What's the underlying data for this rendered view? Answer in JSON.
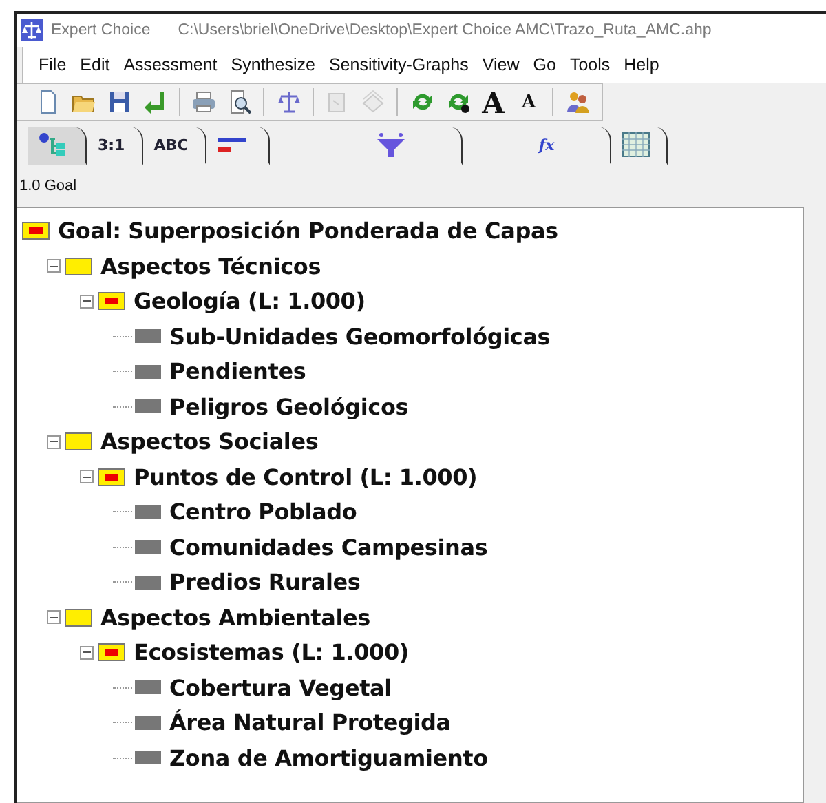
{
  "window": {
    "app": "Expert Choice",
    "path": "C:\\Users\\briel\\OneDrive\\Desktop\\Expert Choice AMC\\Trazo_Ruta_AMC.ahp"
  },
  "menu": [
    {
      "label": "File"
    },
    {
      "label": "Edit"
    },
    {
      "label": "Assessment"
    },
    {
      "label": "Synthesize"
    },
    {
      "label": "Sensitivity-Graphs"
    },
    {
      "label": "View"
    },
    {
      "label": "Go"
    },
    {
      "label": "Tools"
    },
    {
      "label": "Help"
    }
  ],
  "toolbar": [
    {
      "kind": "document",
      "disabled": false
    },
    {
      "kind": "folder",
      "disabled": false
    },
    {
      "kind": "floppy",
      "disabled": false
    },
    {
      "kind": "return",
      "disabled": false
    },
    {
      "kind": "separator"
    },
    {
      "kind": "printer",
      "disabled": false
    },
    {
      "kind": "preview",
      "disabled": false
    },
    {
      "kind": "separator"
    },
    {
      "kind": "scale",
      "disabled": false
    },
    {
      "kind": "separator"
    },
    {
      "kind": "copy",
      "disabled": true
    },
    {
      "kind": "stack",
      "disabled": true
    },
    {
      "kind": "separator"
    },
    {
      "kind": "recycle",
      "disabled": false
    },
    {
      "kind": "recycle-dot",
      "disabled": false
    },
    {
      "kind": "font-up",
      "label": "A",
      "disabled": false
    },
    {
      "kind": "font-down",
      "label": "A",
      "disabled": false
    },
    {
      "kind": "separator"
    },
    {
      "kind": "people",
      "disabled": false
    }
  ],
  "tabs": [
    {
      "kind": "tree",
      "selected": true
    },
    {
      "kind": "text",
      "label": "3:1",
      "selected": false
    },
    {
      "kind": "text",
      "label": "ABC",
      "selected": false
    },
    {
      "kind": "bars",
      "selected": false
    },
    {
      "kind": "funnel",
      "selected": false
    },
    {
      "kind": "formula",
      "label": "fx",
      "selected": false
    },
    {
      "kind": "grid",
      "selected": false
    }
  ],
  "breadcrumb": "1.0 Goal",
  "tree": {
    "kind": "goal",
    "label": "Goal: Superposición Ponderada de Capas",
    "children": [
      {
        "kind": "criterion",
        "label": "Aspectos Técnicos",
        "expanded": true,
        "children": [
          {
            "kind": "subcriterion",
            "label": "Geología (L: 1.000)",
            "expanded": true,
            "children": [
              {
                "kind": "leaf",
                "label": "Sub-Unidades Geomorfológicas"
              },
              {
                "kind": "leaf",
                "label": "Pendientes"
              },
              {
                "kind": "leaf",
                "label": "Peligros Geológicos"
              }
            ]
          }
        ]
      },
      {
        "kind": "criterion",
        "label": "Aspectos Sociales",
        "expanded": true,
        "children": [
          {
            "kind": "subcriterion",
            "label": "Puntos de Control (L: 1.000)",
            "expanded": true,
            "children": [
              {
                "kind": "leaf",
                "label": "Centro Poblado"
              },
              {
                "kind": "leaf",
                "label": "Comunidades Campesinas"
              },
              {
                "kind": "leaf",
                "label": "Predios Rurales"
              }
            ]
          }
        ]
      },
      {
        "kind": "criterion",
        "label": "Aspectos Ambientales",
        "expanded": true,
        "children": [
          {
            "kind": "subcriterion",
            "label": "Ecosistemas (L: 1.000)",
            "expanded": true,
            "children": [
              {
                "kind": "leaf",
                "label": "Cobertura Vegetal"
              },
              {
                "kind": "leaf",
                "label": "Área Natural Protegida"
              },
              {
                "kind": "leaf",
                "label": "Zona de Amortiguamiento"
              }
            ]
          }
        ]
      }
    ]
  }
}
